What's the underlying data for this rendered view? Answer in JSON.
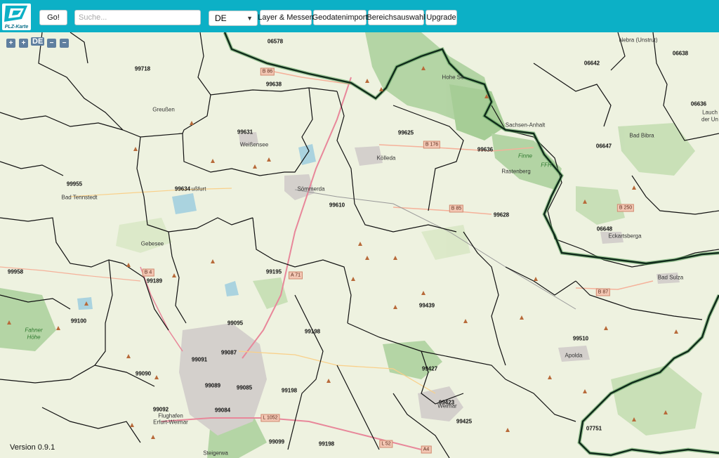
{
  "app": {
    "logo_text": "PLZ-Karte",
    "version": "Version 0.9.1"
  },
  "toolbar": {
    "go_label": "Go!",
    "search_placeholder": "Suche...",
    "country_selected": "DE",
    "buttons": [
      "Layer & Messen",
      "Geodatenimport",
      "Bereichsauswahl",
      "Upgrade"
    ]
  },
  "map_controls": {
    "zoom_in": "+",
    "zoom_in_2": "+",
    "country": "DE",
    "zoom_out": "−"
  },
  "postal_codes": [
    "06578",
    "99718",
    "99638",
    "06642",
    "06638",
    "06636",
    "99631",
    "99625",
    "99636",
    "06647",
    "99955",
    "99634",
    "99610",
    "99628",
    "06648",
    "99958",
    "99189",
    "99195",
    "99439",
    "99100",
    "99095",
    "99198",
    "99510",
    "99091",
    "99087",
    "99090",
    "99089",
    "99085",
    "99427",
    "99092",
    "99084",
    "99423",
    "99425",
    "07751",
    "99099",
    "99198"
  ],
  "towns": [
    "Nebra (Unstrut)",
    "Greußen",
    "Weißensee",
    "Kölleda",
    "Bad Bibra",
    "Lauch",
    "der Un",
    "Bad Tennstedt",
    "Sömmerda",
    "Rastenberg",
    "Eckartsberga",
    "Gebesee",
    "Bad Sulza",
    "Apolda",
    "Weimar",
    "Flughafen",
    "Erfurt-Weimar",
    "Hohe Se",
    "Sachsen-Anhalt",
    "ußfurt",
    "Steigerwa"
  ],
  "roads": [
    "B 86",
    "B 176",
    "B 85",
    "B 250",
    "A 71",
    "B 4",
    "B 87",
    "L 1052",
    "L 52",
    "A4"
  ],
  "areas": [
    "Fahner",
    "Höhe",
    "Finne",
    "FFH"
  ],
  "colors": {
    "topbar": "#0cb0c6",
    "map_base": "#eef2e0",
    "forest": "#add19e",
    "state_border": "#0f2a1a",
    "postal_border": "#111111"
  }
}
